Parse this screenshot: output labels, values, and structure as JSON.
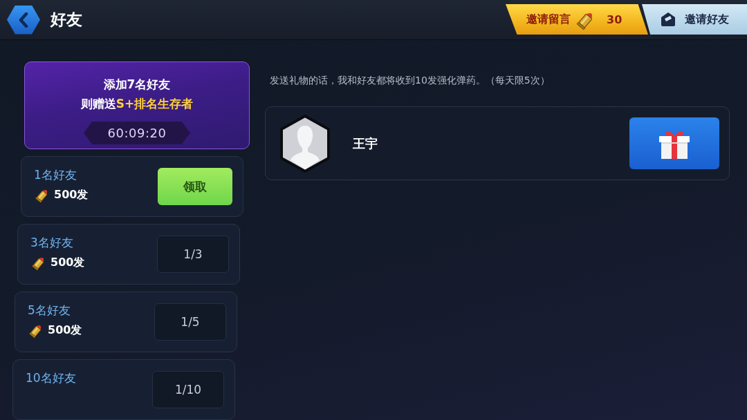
{
  "header": {
    "title": "好友"
  },
  "actions": [
    {
      "kind": "reward",
      "label": "邀请留言",
      "count": "30"
    },
    {
      "kind": "invite",
      "label": "邀请好友"
    }
  ],
  "promo": {
    "title": "添加7名好友",
    "subtitle": "则赠送**S+排名生存者**",
    "timer": "60:09:20"
  },
  "milestones": [
    {
      "kind": "claim",
      "label": "1名好友",
      "reward": "500发",
      "button": "领取"
    },
    {
      "kind": "progress",
      "label": "3名好友",
      "reward": "500发",
      "progress": "1/3"
    },
    {
      "kind": "progress",
      "label": "5名好友",
      "reward": "500发",
      "progress": "1/5"
    },
    {
      "kind": "progress",
      "label": "10名好友",
      "progress": "1/10"
    }
  ],
  "note": "发送礼物的话，我和好友都将收到10发强化弹药。（每天限5次）",
  "friends": [
    {
      "name": "王宇"
    }
  ]
}
